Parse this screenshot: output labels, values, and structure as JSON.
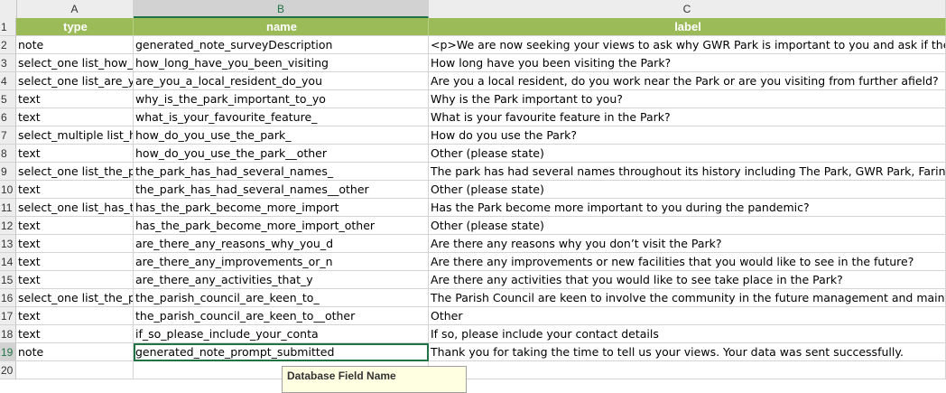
{
  "columns": [
    "A",
    "B",
    "C"
  ],
  "header_row": {
    "num": "1",
    "type": "type",
    "name": "name",
    "label": "label"
  },
  "rows": [
    {
      "num": "2",
      "type": "note",
      "name": "generated_note_surveyDescription",
      "label": "<p>We are now seeking your views to ask why GWR Park is important to you and ask if there a"
    },
    {
      "num": "3",
      "type": "select_one list_how_",
      "name": "how_long_have_you_been_visiting",
      "label": "How long have you been visiting the Park?"
    },
    {
      "num": "4",
      "type": "select_one list_are_y",
      "name": "are_you_a_local_resident_do_you",
      "label": "Are you a local resident, do you work near the Park or are you visiting from further afield?"
    },
    {
      "num": "5",
      "type": "text",
      "name": "why_is_the_park_important_to_yo",
      "label": "Why is the Park important to you?"
    },
    {
      "num": "6",
      "type": "text",
      "name": "what_is_your_favourite_feature_",
      "label": "What is your favourite feature in the Park?"
    },
    {
      "num": "7",
      "type": "select_multiple list_h",
      "name": "how_do_you_use_the_park_",
      "label": "How do you use the Park?"
    },
    {
      "num": "8",
      "type": "text",
      "name": "how_do_you_use_the_park__other",
      "label": "Other (please state)"
    },
    {
      "num": "9",
      "type": "select_one list_the_p",
      "name": "the_park_has_had_several_names_",
      "label": "The park has had several names throughout its history including The Park, GWR Park, Faringdo"
    },
    {
      "num": "10",
      "type": "text",
      "name": "the_park_has_had_several_names__other",
      "label": "Other (please state)"
    },
    {
      "num": "11",
      "type": "select_one list_has_t",
      "name": "has_the_park_become_more_import",
      "label": "Has the Park become more important to you during the pandemic?"
    },
    {
      "num": "12",
      "type": "text",
      "name": "has_the_park_become_more_import_other",
      "label": "Other (please state)"
    },
    {
      "num": "13",
      "type": "text",
      "name": "are_there_any_reasons_why_you_d",
      "label": "Are there any reasons why you don’t visit the Park?"
    },
    {
      "num": "14",
      "type": "text",
      "name": "are_there_any_improvements_or_n",
      "label": "Are there any improvements or new facilities that you would like to see in the future?"
    },
    {
      "num": "15",
      "type": "text",
      "name": "are_there_any_activities_that_y",
      "label": "Are there any activities that you would like to see take place in the Park?"
    },
    {
      "num": "16",
      "type": "select_one list_the_p",
      "name": "the_parish_council_are_keen_to_",
      "label": "The Parish Council are keen to involve the community in the future management and mainte"
    },
    {
      "num": "17",
      "type": "text",
      "name": "the_parish_council_are_keen_to__other",
      "label": "Other"
    },
    {
      "num": "18",
      "type": "text",
      "name": "if_so_please_include_your_conta",
      "label": "If so, please include your contact details"
    },
    {
      "num": "19",
      "type": "note",
      "name": "generated_note_prompt_submitted",
      "label": "Thank you for taking the time to tell us your views.  Your data was sent successfully."
    },
    {
      "num": "20",
      "type": "",
      "name": "",
      "label": ""
    }
  ],
  "tooltip": "Database Field Name"
}
